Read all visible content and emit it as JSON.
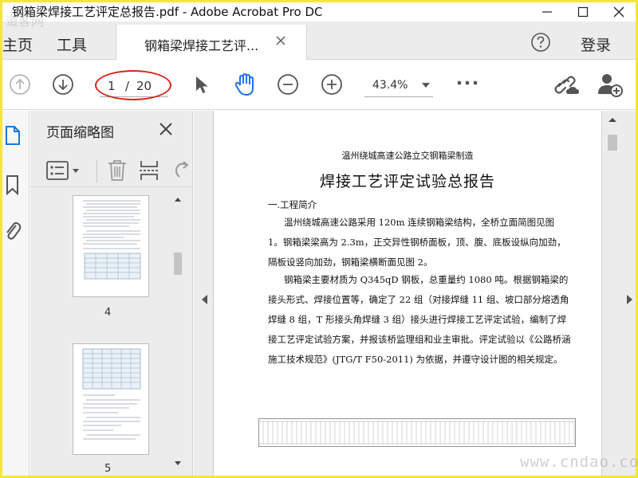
{
  "window": {
    "title": "钢箱梁焊接工艺评定总报告.pdf - Adobe Acrobat Pro DC"
  },
  "tabs": {
    "home_label": "主页",
    "tools_label": "工具",
    "document_label": "钢箱梁焊接工艺评...",
    "login_label": "登录"
  },
  "toolbar": {
    "page_current": "1",
    "page_total": "20",
    "page_separator": "/",
    "zoom": "43.4%",
    "ring_color": "#d8231b",
    "active_tool_color": "#1a73e8"
  },
  "thumbnails": {
    "panel_title": "页面缩略图",
    "pages": [
      "4",
      "5"
    ]
  },
  "document": {
    "subtitle": "温州绕城高速公路立交钢箱梁制造",
    "title": "焊接工艺评定试验总报告",
    "section": "一.工程简介",
    "paragraphs": [
      "温州绕城高速公路采用 120m 连续钢箱梁结构，全桥立面简图见图 1。钢箱梁梁高为 2.3m，正交异性钢桥面板，顶、腹、底板设纵向加劲，隔板设竖向加劲，钢箱梁横断面见图 2。",
      "钢箱梁主要材质为 Q345qD 钢板，总重量约 1080 吨。根据钢箱梁的接头形式、焊接位置等，确定了 22 组（对接焊缝 11 组、坡口部分熔透角焊缝 8 组，T 形接头角焊缝 3 组）接头进行焊接工艺评定试验，编制了焊接工艺评定试验方案，并报该桥监理组和业主审批。评定试验以《公路桥涵施工技术规范》(JTG/T F50-2011) 为依据，并遵守设计图的相关规定。"
    ]
  },
  "watermark": {
    "text": "www.cndao.com",
    "corner_text": "道客网"
  }
}
